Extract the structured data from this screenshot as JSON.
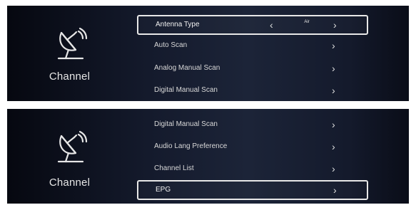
{
  "screen1": {
    "side": {
      "icon": "satellite-dish-icon",
      "label": "Channel"
    },
    "items": [
      {
        "label": "Antenna Type",
        "value": "Air",
        "selected": true
      },
      {
        "label": "Auto Scan"
      },
      {
        "label": "Analog Manual Scan"
      },
      {
        "label": "Digital Manual Scan"
      }
    ]
  },
  "screen2": {
    "side": {
      "icon": "satellite-dish-icon",
      "label": "Channel"
    },
    "items": [
      {
        "label": "Digital Manual Scan"
      },
      {
        "label": "Audio Lang Preference"
      },
      {
        "label": "Channel List"
      },
      {
        "label": "EPG",
        "selected": true
      }
    ]
  },
  "glyphs": {
    "left_arrow": "‹",
    "right_arrow": "›"
  }
}
